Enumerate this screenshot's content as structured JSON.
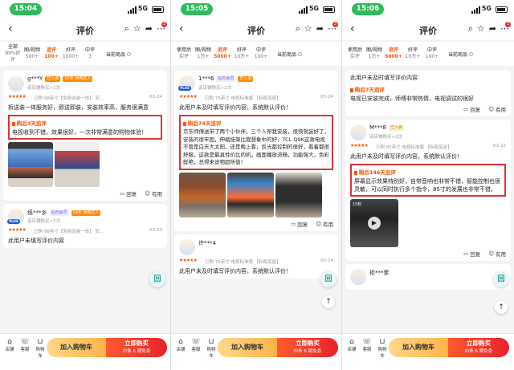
{
  "screens": [
    {
      "time": "15:04",
      "network": "5G",
      "title": "评价",
      "notif": "3",
      "filters": [
        {
          "label": "全部",
          "count": "99%好评"
        },
        {
          "label": "图/视频",
          "count": "500+"
        },
        {
          "label": "追评",
          "count": "100+"
        },
        {
          "label": "好评",
          "count": "1000+"
        },
        {
          "label": "中评",
          "count": "3"
        }
      ],
      "current_goods": "当前商品",
      "reviews": [
        {
          "user": "g***Y",
          "tags": [
            "已入会",
            "10年 网购达人"
          ],
          "meta": "该店铺购买>2次",
          "spec": "已购 98英寸【免费送装一体】 安...",
          "date": "03-24",
          "text": "拆送装一体服务好，即送即装，安装效率高，服务很满意",
          "followup_title": "购后3天追评",
          "followup_text": "电视收到不错，效果很好，一次非常满意的购物体验！",
          "reply": "回复",
          "useful": "有用"
        },
        {
          "user": "纸***乡",
          "tags": [
            "钻石会员",
            "14年 网购达人"
          ],
          "meta": "该店铺购买>2次",
          "spec": "已购 98英寸【免费送装一体】 安...",
          "date": "03-23",
          "text": "此用户未填写评价内容"
        }
      ],
      "bottom": {
        "store": "店铺",
        "service": "客服",
        "cart": "购物车",
        "add_cart": "加入购物车",
        "buy": "立即购买",
        "buy_sub": "白条 6 期免息"
      }
    },
    {
      "time": "15:05",
      "network": "5G",
      "title": "评价",
      "notif": "3",
      "filters": [
        {
          "label": "使用后",
          "count": "实评"
        },
        {
          "label": "图/视频",
          "count": "1万+"
        },
        {
          "label": "追评",
          "count": "5000+"
        },
        {
          "label": "好评",
          "count": "10万+"
        },
        {
          "label": "中评",
          "count": "100+"
        }
      ],
      "current_goods": "当前商品",
      "reviews": [
        {
          "user": "1***6",
          "tags": [
            "钻石会员",
            "已入会"
          ],
          "meta": "该店铺购买>2次",
          "spec": "已购 75英寸 电视标准版 【标配底座】",
          "date": "03-24",
          "text": "此用户未及时填写评价内容，系统默认评价！",
          "followup_title": "购后74天追评",
          "followup_text": "京东师傅送带了两个小伙伴，三个人帮我安装，很快就装好了，安装的很牢固，伸缩挂架比我想象中的好，TCL Q9K这款电视不管是白天大太阳，还是晚上看，反光都控制的很好，看着都很舒服，这款是最具性价比的机，画面播放流畅，功能强大，色彩鲜艳，总得来说物超所值！",
          "reply": "回复",
          "useful": "有用"
        },
        {
          "user": "许***4",
          "tags": [],
          "meta": "",
          "spec": "已购 75英寸 电视标准版 【标配底座】",
          "date": "03-24",
          "text": "此用户未及时填写评价内容，系统默认评价！"
        }
      ],
      "bottom": {
        "store": "店铺",
        "service": "客服",
        "cart": "购物车",
        "add_cart": "加入购物车",
        "buy": "立即购买",
        "buy_sub": "白条 6 期免息"
      }
    },
    {
      "time": "15:06",
      "network": "5G",
      "title": "评价",
      "notif": "3",
      "filters": [
        {
          "label": "使用后",
          "count": "实评"
        },
        {
          "label": "图/视频",
          "count": "1万+"
        },
        {
          "label": "追评",
          "count": "5000+"
        },
        {
          "label": "好评",
          "count": "10万+"
        },
        {
          "label": "中评",
          "count": "100+"
        }
      ],
      "current_goods": "当前商品",
      "reviews": [
        {
          "text_top": "此用户未及时填写评价内容",
          "followup_title": "购后7天追评",
          "followup_text": "电视已安装完成，师傅非常热情，电视调试的很好",
          "reply": "回复",
          "useful": "有用"
        },
        {
          "user": "M***8",
          "tags": [
            "已入会"
          ],
          "meta": "该店铺购买>2次",
          "spec": "已购 85英寸 电视标准版 【标配底座】",
          "date": "03-22",
          "text": "此用户未及时填写评价内容，系统默认评价！",
          "followup_title": "购后146天追评",
          "followup_text": "屏幕显示效果特别好，自带音响也非常不错，智能控制也很灵敏，可以同时执行多个指令，85寸的发展也非常不错。",
          "video_len": "15秒",
          "reply": "回复",
          "useful": "有用"
        },
        {
          "user": "拒***爹",
          "tags": [],
          "meta": ""
        }
      ],
      "bottom": {
        "store": "店铺",
        "service": "客服",
        "cart": "购物车",
        "add_cart": "加入购物车",
        "buy": "立即购买",
        "buy_sub": "白条 6 期免息"
      }
    }
  ]
}
